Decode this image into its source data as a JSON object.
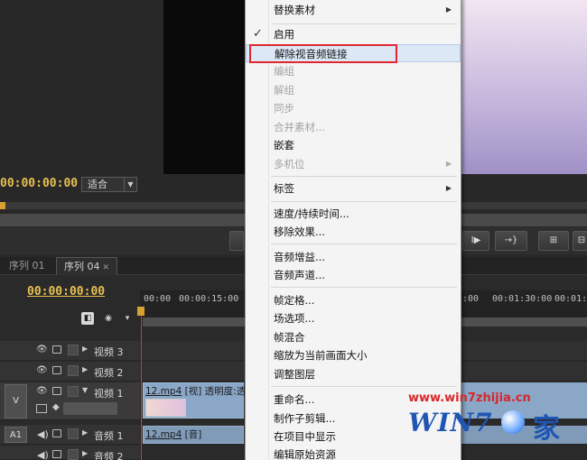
{
  "program_monitor": {
    "timecode": "00:00:00:00",
    "fit_label": "适合"
  },
  "sequence_tabs": [
    {
      "label": "序列 01"
    },
    {
      "label": "序列 04"
    }
  ],
  "timeline": {
    "timecode": "00:00:00:00",
    "ruler_labels": [
      "00:00",
      "00:00:15:00",
      ":00",
      "00:01:30:00",
      "00:01:4"
    ],
    "tracks": {
      "v3": {
        "name": "视频 3"
      },
      "v2": {
        "name": "视频 2"
      },
      "v1": {
        "slot": "V",
        "name": "视频 1"
      },
      "a1": {
        "slot": "A1",
        "name": "音频 1"
      },
      "a2": {
        "name": "音频 2"
      }
    },
    "video_clip": {
      "file": "12.mp4",
      "tag": "[视]",
      "effect": "透明度:透"
    },
    "audio_clip": {
      "file": "12.mp4",
      "tag": "[音]"
    }
  },
  "context_menu": {
    "items": [
      {
        "label": "替换素材",
        "enabled": true,
        "submenu": true
      },
      {
        "label": "启用",
        "enabled": true,
        "checked": true
      },
      {
        "label": "解除视音频链接",
        "enabled": true,
        "hovered": true
      },
      {
        "label": "编组",
        "enabled": false
      },
      {
        "label": "解组",
        "enabled": false
      },
      {
        "label": "同步",
        "enabled": false
      },
      {
        "label": "合并素材...",
        "enabled": false
      },
      {
        "label": "嵌套",
        "enabled": true
      },
      {
        "label": "多机位",
        "enabled": false,
        "submenu": true
      },
      {
        "label": "标签",
        "enabled": true,
        "submenu": true
      },
      {
        "label": "速度/持续时间...",
        "enabled": true
      },
      {
        "label": "移除效果...",
        "enabled": true
      },
      {
        "label": "音频增益...",
        "enabled": true
      },
      {
        "label": "音频声道...",
        "enabled": true
      },
      {
        "label": "帧定格...",
        "enabled": true
      },
      {
        "label": "场选项...",
        "enabled": true
      },
      {
        "label": "帧混合",
        "enabled": true
      },
      {
        "label": "缩放为当前画面大小",
        "enabled": true
      },
      {
        "label": "调整图层",
        "enabled": true
      },
      {
        "label": "重命名...",
        "enabled": true
      },
      {
        "label": "制作子剪辑...",
        "enabled": true
      },
      {
        "label": "在项目中显示",
        "enabled": true
      },
      {
        "label": "编辑原始资源",
        "enabled": true
      }
    ]
  },
  "watermark": {
    "url": "www.win7zhijia.cn",
    "logo": "WIN7",
    "suffix": "家"
  },
  "colors": {
    "timecode": "#e8c050",
    "highlight": "#e0262e",
    "clip_video": "#8aa7c8",
    "clip_audio": "#7f9bb8"
  }
}
